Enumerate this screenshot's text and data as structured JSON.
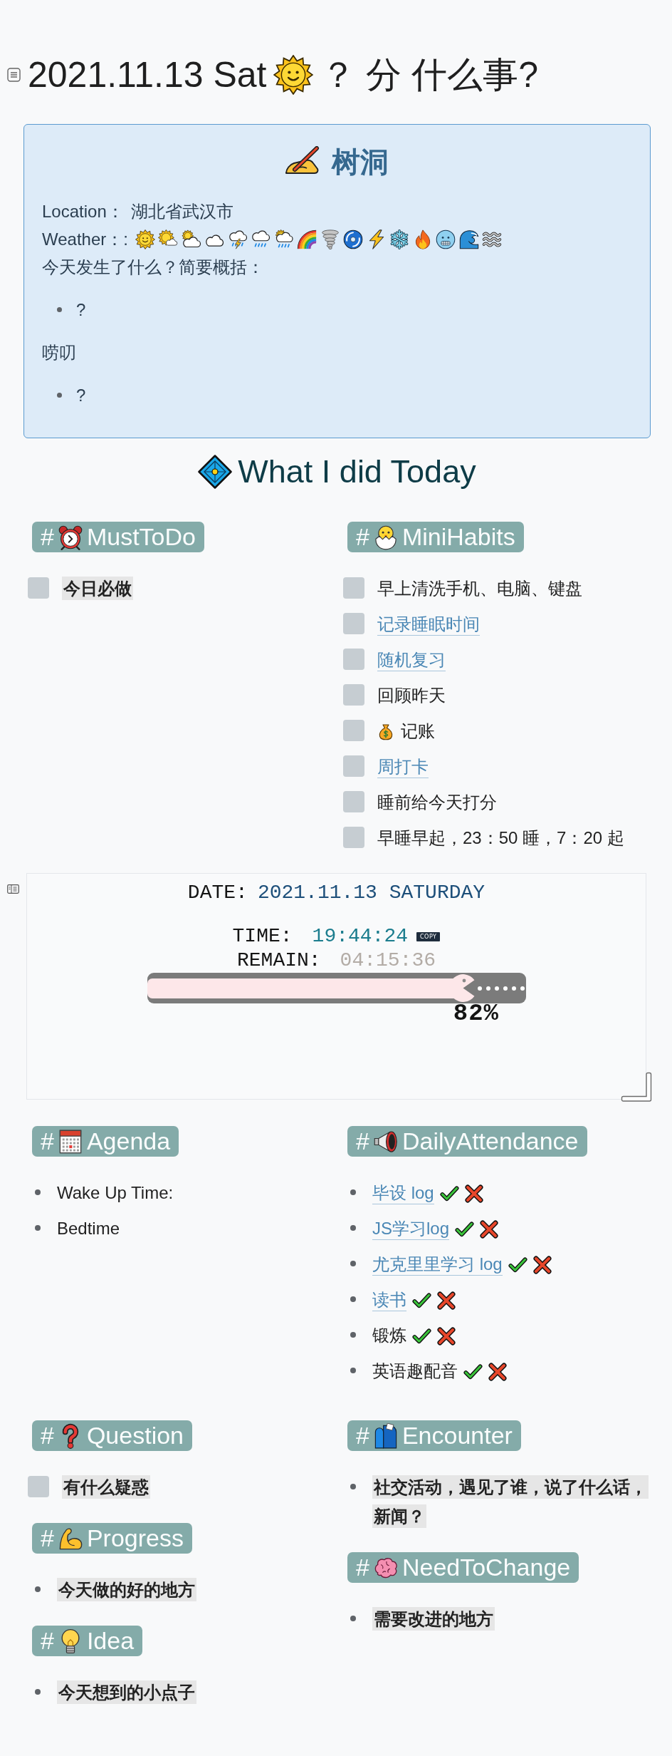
{
  "heading": {
    "date": "2021.11.13 Sat",
    "suffix": "？ 分 什么事?"
  },
  "tree_hole": {
    "title": "树洞",
    "location_label": "Location：",
    "location": "湖北省武汉市",
    "weather_label": "Weather：:",
    "prompt": "今天发生了什么？简要概括：",
    "summary": [
      "?"
    ],
    "notes_label": "唠叨",
    "notes": [
      "?"
    ]
  },
  "section_title": "What I did Today",
  "board_top": [
    [
      {
        "hash": "#",
        "label": "MustToDo",
        "kind": "checklist",
        "items": [
          {
            "text": "今日必做",
            "kind": "highlight",
            "checked": false
          }
        ]
      }
    ],
    [
      {
        "hash": "#",
        "label": "MiniHabits",
        "kind": "checklist",
        "items": [
          {
            "text": "早上清洗手机、电脑、键盘",
            "kind": "text",
            "checked": false
          },
          {
            "text": "记录睡眠时间",
            "kind": "link",
            "checked": false
          },
          {
            "text": "随机复习",
            "kind": "link",
            "checked": false
          },
          {
            "text": "回顾昨天",
            "kind": "text",
            "checked": false
          },
          {
            "text": "记账",
            "kind": "emoji",
            "checked": false
          },
          {
            "text": "周打卡",
            "kind": "link",
            "checked": false
          },
          {
            "text": "睡前给今天打分",
            "kind": "text",
            "checked": false
          },
          {
            "text": "早睡早起，23：50 睡，7：20 起",
            "kind": "text",
            "checked": false
          }
        ]
      }
    ]
  ],
  "clock": {
    "date_label": "DATE:",
    "date": "2021.11.13 SATURDAY",
    "time_label": "TIME:",
    "time": "19:44:24",
    "copy_button": "COPY",
    "remain_label": "REMAIN:",
    "remain": "04:15:36",
    "level": 0.82,
    "percent": "82%"
  },
  "board_middle": [
    [
      {
        "hash": "#",
        "label": "Agenda",
        "kind": "bullets",
        "items": [
          {
            "text": "Wake Up Time:",
            "kind": "text"
          },
          {
            "text": "Bedtime",
            "kind": "text"
          }
        ]
      }
    ],
    [
      {
        "hash": "#",
        "label": "DailyAttendance",
        "kind": "attendance",
        "items": [
          {
            "text": "毕设 log",
            "kind": "link"
          },
          {
            "text": "JS学习log",
            "kind": "link"
          },
          {
            "text": "尤克里里学习 log",
            "kind": "link"
          },
          {
            "text": "读书",
            "kind": "link"
          },
          {
            "text": "锻炼",
            "kind": "text"
          },
          {
            "text": "英语趣配音",
            "kind": "text"
          }
        ]
      }
    ]
  ],
  "board_bottom": [
    [
      {
        "hash": "#",
        "label": "Question",
        "kind": "checklist",
        "items": [
          {
            "text": "有什么疑惑",
            "kind": "highlight",
            "checked": false
          }
        ]
      },
      {
        "hash": "#",
        "label": "Progress",
        "kind": "bullets",
        "items": [
          {
            "text": "今天做的好的地方",
            "kind": "highlight"
          }
        ]
      },
      {
        "hash": "#",
        "label": "Idea",
        "kind": "bullets",
        "items": [
          {
            "text": "今天想到的小点子",
            "kind": "highlight"
          }
        ]
      }
    ],
    [
      {
        "hash": "#",
        "label": "Encounter",
        "kind": "bullets",
        "items": [
          {
            "text": "社交活动，遇见了谁，说了什么话，新闻？",
            "kind": "highlight"
          }
        ]
      },
      {
        "hash": "#",
        "label": "NeedToChange",
        "kind": "bullets",
        "items": [
          {
            "text": "需要改进的地方",
            "kind": "highlight"
          }
        ]
      }
    ]
  ]
}
